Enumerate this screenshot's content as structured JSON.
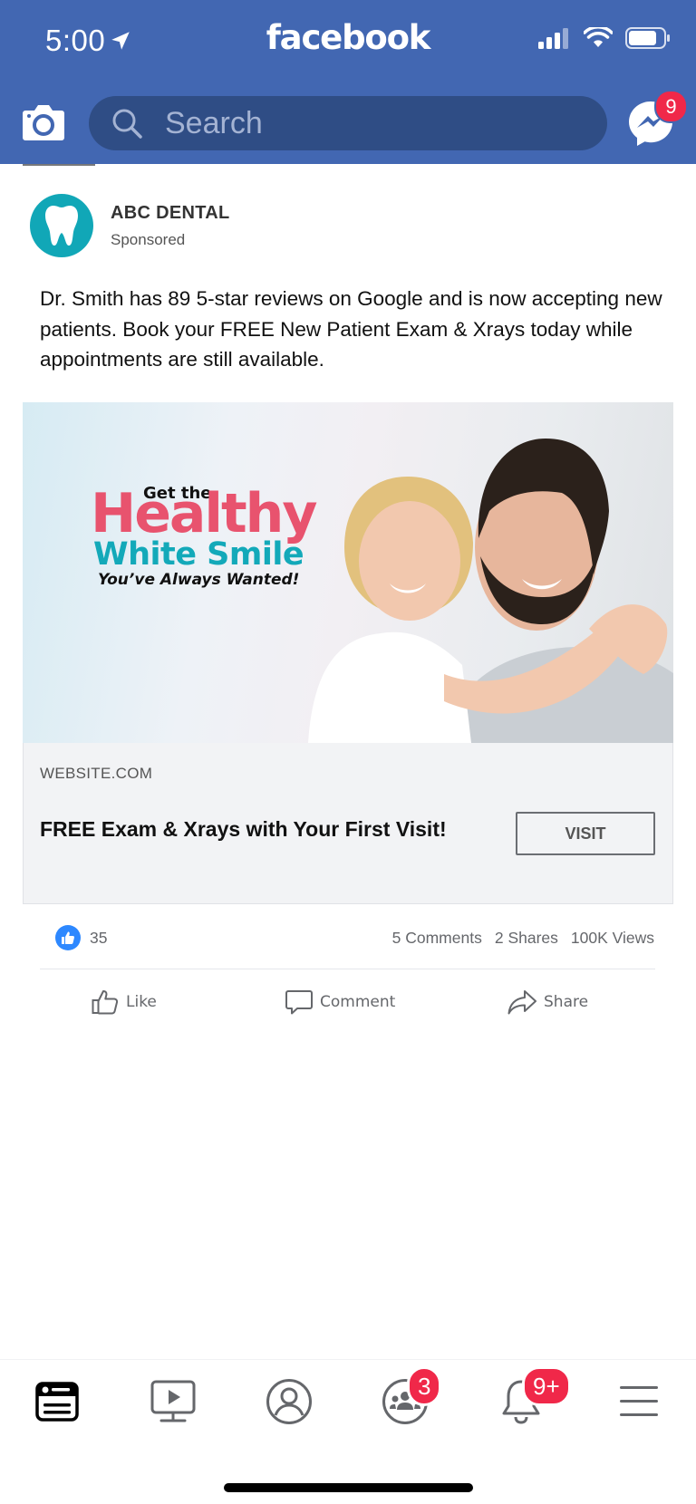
{
  "status_bar": {
    "time": "5:00"
  },
  "header": {
    "brand": "facebook",
    "search_placeholder": "Search",
    "messenger_badge": "9",
    "accent_color": "#4267b2",
    "badge_color": "#f02849"
  },
  "post": {
    "page_name": "ABC DENTAL",
    "sponsored_label": "Sponsored",
    "text": "Dr. Smith has 89 5-star reviews on Google and is now accepting new patients. Book your FREE New Patient Exam & Xrays today while appointments are still available.",
    "ad_image": {
      "line1": "Get the",
      "line2": "Healthy",
      "line3": "White Smile",
      "line4": "You’ve Always Wanted!"
    },
    "link_card": {
      "domain": "WEBSITE.COM",
      "title": "FREE Exam & Xrays with Your First Visit!",
      "cta": "VISIT"
    },
    "stats": {
      "likes": "35",
      "comments": "5 Comments",
      "shares": "2 Shares",
      "views": "100K Views"
    },
    "actions": {
      "like": "Like",
      "comment": "Comment",
      "share": "Share"
    }
  },
  "bottom_nav": {
    "items": [
      "news-feed",
      "watch",
      "profile",
      "groups",
      "notifications",
      "menu"
    ],
    "groups_badge": "3",
    "notifications_badge": "9+"
  }
}
